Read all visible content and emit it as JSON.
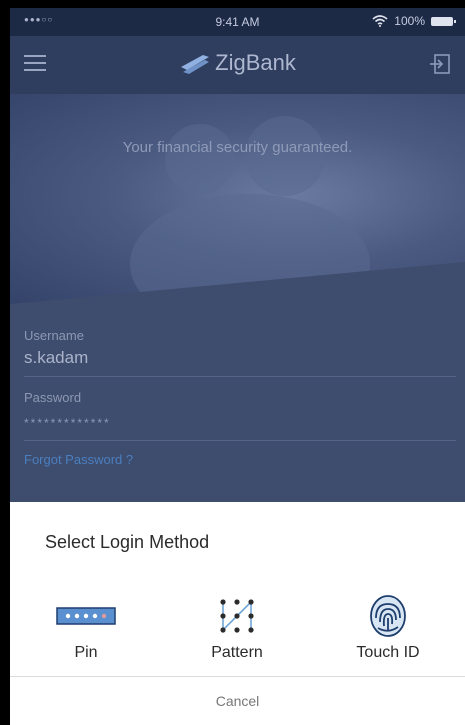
{
  "status": {
    "signal": "●●●○○",
    "time": "9:41 AM",
    "battery": "100%"
  },
  "header": {
    "brand": "ZigBank"
  },
  "hero": {
    "tagline": "Your financial security guaranteed."
  },
  "form": {
    "username_label": "Username",
    "username_value": "s.kadam",
    "password_label": "Password",
    "password_value": "*************",
    "forgot_link": "Forgot Password ?"
  },
  "sheet": {
    "title": "Select Login Method",
    "methods": [
      {
        "label": "Pin",
        "icon": "pin-icon"
      },
      {
        "label": "Pattern",
        "icon": "pattern-icon"
      },
      {
        "label": "Touch ID",
        "icon": "fingerprint-icon"
      }
    ],
    "cancel": "Cancel"
  },
  "colors": {
    "header": "#2f3d5e",
    "accent": "#1f57b0",
    "link": "#4a7fc0",
    "sheet": "#ffffff"
  }
}
